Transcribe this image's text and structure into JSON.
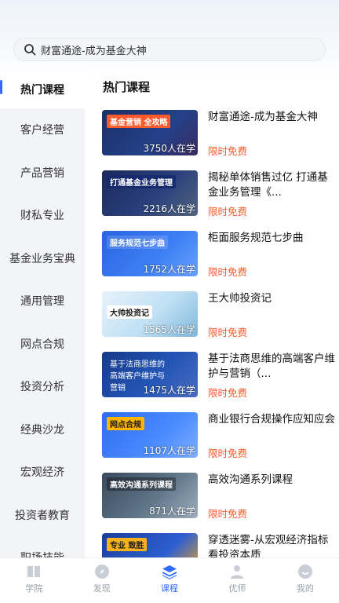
{
  "search": {
    "placeholder": "财富通途-成为基金大神"
  },
  "sidebar": {
    "items": [
      {
        "label": "热门课程"
      },
      {
        "label": "客户经营"
      },
      {
        "label": "产品营销"
      },
      {
        "label": "财私专业"
      },
      {
        "label": "基金业务宝典"
      },
      {
        "label": "通用管理"
      },
      {
        "label": "网点合规"
      },
      {
        "label": "投资分析"
      },
      {
        "label": "经典沙龙"
      },
      {
        "label": "宏观经济"
      },
      {
        "label": "投资者教育"
      },
      {
        "label": "职场技能"
      }
    ]
  },
  "main": {
    "section_title": "热门课程",
    "courses": [
      {
        "title": "财富通途-成为基金大神",
        "badge": "限时免费",
        "stat": "3750人在学",
        "thumb_text": "基金营销 全攻略",
        "icon": "course-thumbnail"
      },
      {
        "title": "揭秘单体销售过亿 打通基金业务管理《...",
        "badge": "限时免费",
        "stat": "2216人在学",
        "thumb_text": "打通基金业务管理",
        "icon": "course-thumbnail"
      },
      {
        "title": "柜面服务规范七步曲",
        "badge": "限时免费",
        "stat": "1752人在学",
        "thumb_text": "服务规范七步曲",
        "icon": "course-thumbnail"
      },
      {
        "title": "王大帅投资记",
        "badge": "限时免费",
        "stat": "1565人在学",
        "thumb_text": "大帅投资记",
        "icon": "course-thumbnail"
      },
      {
        "title": "基于法商思维的高端客户维护与营销（...",
        "badge": "限时免费",
        "stat": "1475人在学",
        "thumb_text": "基于法商思维的高端客户维护与营销",
        "icon": "course-thumbnail"
      },
      {
        "title": "商业银行合规操作应知应会",
        "badge": "限时免费",
        "stat": "1107人在学",
        "thumb_text": "网点合规",
        "icon": "course-thumbnail"
      },
      {
        "title": "高效沟通系列课程",
        "badge": "限时免费",
        "stat": "871人在学",
        "thumb_text": "高效沟通系列课程",
        "icon": "course-thumbnail"
      },
      {
        "title": "穿透迷雾-从宏观经济指标看投资本质",
        "badge": "",
        "stat": "",
        "thumb_text": "专业 致胜",
        "icon": "course-thumbnail"
      }
    ]
  },
  "tabbar": {
    "items": [
      {
        "label": "学院",
        "icon": "book-icon"
      },
      {
        "label": "发现",
        "icon": "compass-icon"
      },
      {
        "label": "课程",
        "icon": "layers-icon"
      },
      {
        "label": "优师",
        "icon": "teacher-icon"
      },
      {
        "label": "我的",
        "icon": "profile-icon"
      }
    ],
    "active": "课程"
  },
  "colors": {
    "accent": "#2f6bff",
    "badge": "#ff5a2c",
    "sidebar_bg": "#f3f4f8"
  }
}
